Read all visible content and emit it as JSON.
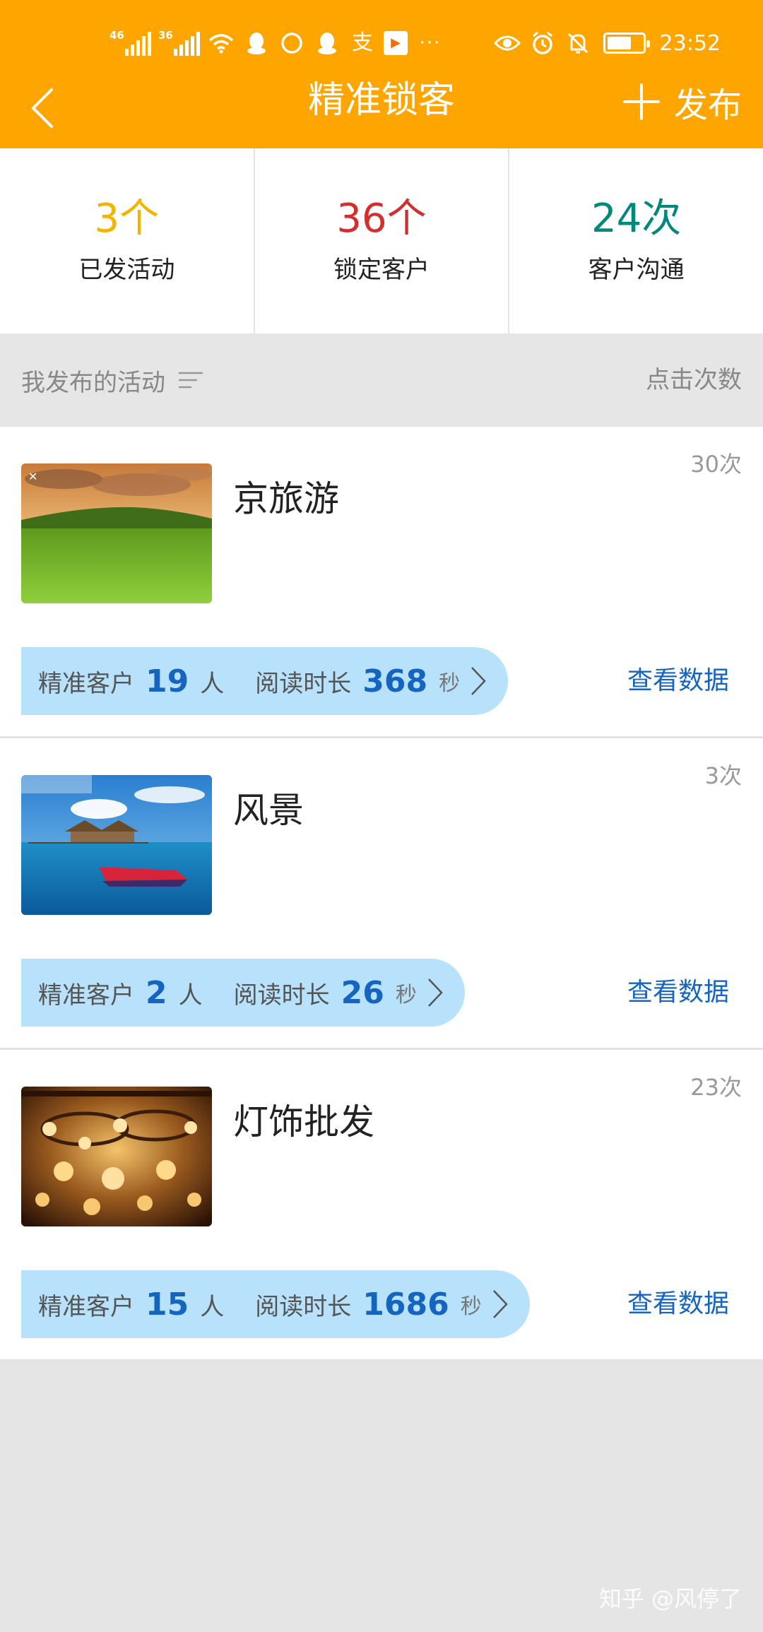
{
  "status_bar": {
    "signal_1_tag": "46",
    "signal_2_tag": "36",
    "time": "23:52",
    "battery_level": 0.7,
    "icons": [
      "signal-icon",
      "signal-icon",
      "wifi-icon",
      "qq-icon",
      "circle-icon",
      "qq-icon",
      "alipay-icon",
      "video-app-icon",
      "more-dots-icon",
      "eye-icon",
      "alarm-icon",
      "mute-bell-icon",
      "battery-icon"
    ]
  },
  "header": {
    "title": "精准锁客",
    "publish_label": "发布",
    "background_color": "#ffa500"
  },
  "stats": [
    {
      "value": "3个",
      "label": "已发活动",
      "color": "#f2b400"
    },
    {
      "value": "36个",
      "label": "锁定客户",
      "color": "#d32f2f"
    },
    {
      "value": "24次",
      "label": "客户沟通",
      "color": "#00897b"
    }
  ],
  "section": {
    "title": "我发布的活动",
    "sort_label": "点击次数"
  },
  "activities": [
    {
      "title": "京旅游",
      "clicks": "30次",
      "precise_label": "精准客户",
      "precise_count": "19",
      "precise_unit": "人",
      "read_label": "阅读时长",
      "read_duration": "368",
      "read_unit": "秒",
      "view_data": "查看数据",
      "image": "grassland-landscape"
    },
    {
      "title": "风景",
      "clicks": "3次",
      "precise_label": "精准客户",
      "precise_count": "2",
      "precise_unit": "人",
      "read_label": "阅读时长",
      "read_duration": "26",
      "read_unit": "秒",
      "view_data": "查看数据",
      "image": "sea-speedboat"
    },
    {
      "title": "灯饰批发",
      "clicks": "23次",
      "precise_label": "精准客户",
      "precise_count": "15",
      "precise_unit": "人",
      "read_label": "阅读时长",
      "read_duration": "1686",
      "read_unit": "秒",
      "view_data": "查看数据",
      "image": "chandeliers"
    }
  ],
  "watermark": "知乎 @风停了"
}
